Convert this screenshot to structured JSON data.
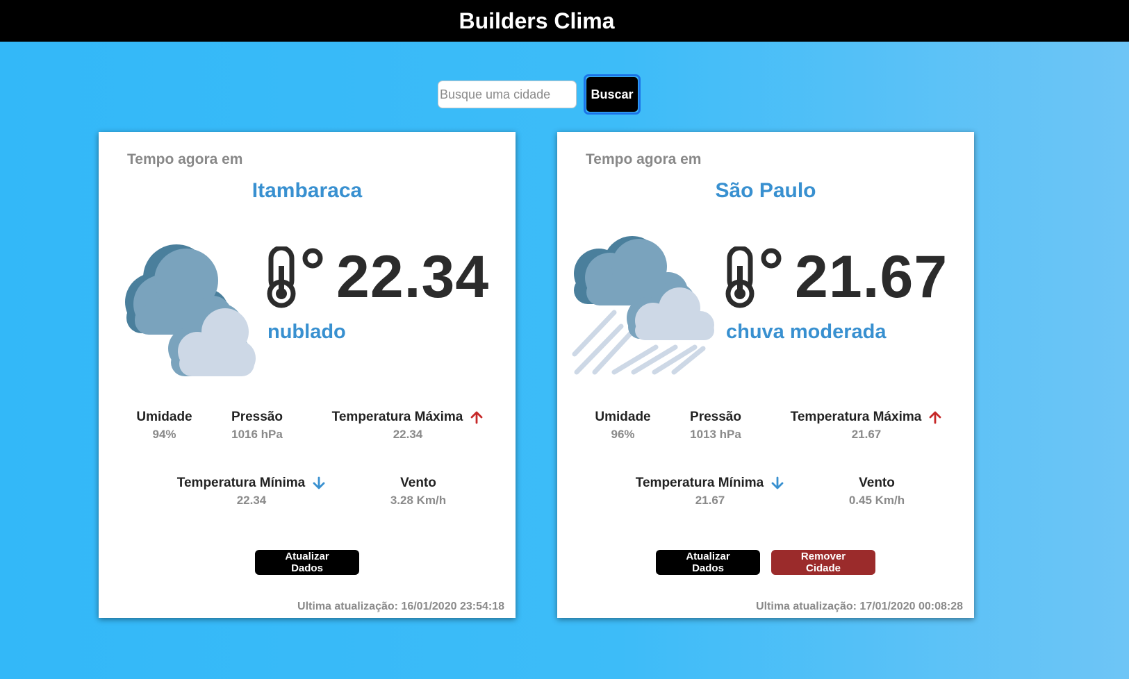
{
  "header": {
    "title": "Builders Clima"
  },
  "search": {
    "placeholder": "Busque uma cidade",
    "button_label": "Buscar"
  },
  "colors": {
    "accent": "#3890d0",
    "max_arrow": "#c62828",
    "min_arrow": "#3890d0",
    "remove": "#9b2b2b"
  },
  "cards": [
    {
      "heading": "Tempo agora em",
      "city": "Itambaraca",
      "icon": "cloudy-icon",
      "temperature": "22.34",
      "description": "nublado",
      "humidity_label": "Umidade",
      "humidity": "94%",
      "pressure_label": "Pressão",
      "pressure": "1016 hPa",
      "max_label": "Temperatura Máxima",
      "max": "22.34",
      "min_label": "Temperatura Mínima",
      "min": "22.34",
      "wind_label": "Vento",
      "wind": "3.28 Km/h",
      "update_label": "Atualizar Dados",
      "last_update": "Ultima atualização: 16/01/2020 23:54:18"
    },
    {
      "heading": "Tempo agora em",
      "city": "São Paulo",
      "icon": "rain-cloud-icon",
      "temperature": "21.67",
      "description": "chuva moderada",
      "humidity_label": "Umidade",
      "humidity": "96%",
      "pressure_label": "Pressão",
      "pressure": "1013 hPa",
      "max_label": "Temperatura Máxima",
      "max": "21.67",
      "min_label": "Temperatura Mínima",
      "min": "21.67",
      "wind_label": "Vento",
      "wind": "0.45 Km/h",
      "update_label": "Atualizar Dados",
      "remove_label": "Remover Cidade",
      "last_update": "Ultima atualização: 17/01/2020 00:08:28"
    }
  ]
}
